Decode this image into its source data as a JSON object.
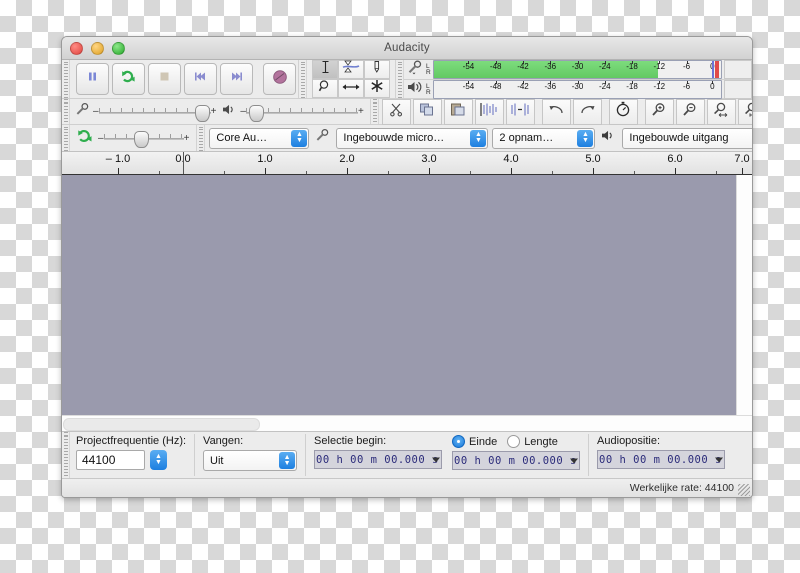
{
  "window": {
    "title": "Audacity",
    "traffic_lights": [
      "close-red",
      "minimize-yellow",
      "maximize-green"
    ]
  },
  "transport": {
    "buttons": [
      {
        "name": "pause-button",
        "icon": "pause-icon",
        "label": "Pause"
      },
      {
        "name": "play-button",
        "icon": "play-loop-icon",
        "label": "Play"
      },
      {
        "name": "stop-button",
        "icon": "stop-icon",
        "label": "Stop"
      },
      {
        "name": "skip-start-button",
        "icon": "skip-to-start-icon",
        "label": "Skip to Start"
      },
      {
        "name": "skip-end-button",
        "icon": "skip-to-end-icon",
        "label": "Skip to End"
      },
      {
        "name": "record-button",
        "icon": "record-icon",
        "label": "Record"
      }
    ]
  },
  "tools": {
    "items": [
      {
        "name": "selection-tool",
        "icon": "i-beam-icon",
        "active": true
      },
      {
        "name": "envelope-tool",
        "icon": "envelope-icon",
        "active": false
      },
      {
        "name": "draw-tool",
        "icon": "pencil-icon",
        "active": false
      },
      {
        "name": "zoom-tool",
        "icon": "magnifier-icon",
        "active": false
      },
      {
        "name": "timeshift-tool",
        "icon": "arrows-horizontal-icon",
        "active": false
      },
      {
        "name": "multi-tool",
        "icon": "asterisk-icon",
        "active": false
      }
    ]
  },
  "meters": {
    "record": {
      "icon": "microphone-icon",
      "channels": [
        "L",
        "R"
      ],
      "ticks": [
        "-54",
        "-48",
        "-42",
        "-36",
        "-30",
        "-24",
        "-18",
        "-12",
        "-6",
        "0"
      ],
      "level_percent": 78
    },
    "play": {
      "icon": "speaker-icon",
      "channels": [
        "L",
        "R"
      ],
      "ticks": [
        "-54",
        "-48",
        "-42",
        "-36",
        "-30",
        "-24",
        "-18",
        "-12",
        "-6",
        "0"
      ],
      "level_percent": 0
    }
  },
  "mixer": {
    "record_icon": "microphone-icon",
    "play_icon": "speaker-icon",
    "minus": "–",
    "plus": "+",
    "record_value_percent": 86,
    "play_value_percent": 5
  },
  "edit_toolbar": {
    "buttons": [
      {
        "name": "cut-button",
        "icon": "scissors-icon"
      },
      {
        "name": "copy-button",
        "icon": "copy-icon"
      },
      {
        "name": "paste-button",
        "icon": "paste-icon"
      },
      {
        "name": "trim-button",
        "icon": "trim-audio-icon"
      },
      {
        "name": "silence-button",
        "icon": "silence-audio-icon"
      },
      {
        "name": "undo-button",
        "icon": "undo-arrow-icon"
      },
      {
        "name": "redo-button",
        "icon": "redo-arrow-icon"
      },
      {
        "name": "sync-lock-button",
        "icon": "stopwatch-icon"
      },
      {
        "name": "zoom-in-button",
        "icon": "zoom-in-icon"
      },
      {
        "name": "zoom-out-button",
        "icon": "zoom-out-icon"
      },
      {
        "name": "fit-selection-button",
        "icon": "zoom-fit-selection-icon"
      },
      {
        "name": "fit-project-button",
        "icon": "zoom-fit-project-icon"
      }
    ]
  },
  "transcription": {
    "play_at_speed_icon": "play-at-speed-icon"
  },
  "device_toolbar": {
    "host_icon": "loop-green-icon",
    "host": "Core Au…",
    "input_icon": "microphone-icon",
    "input_device": "Ingebouwde micro…",
    "channels": "2 opnam…",
    "output_icon": "speaker-icon",
    "output_device": "Ingebouwde uitgang"
  },
  "ruler": {
    "labels": [
      "– 1.0",
      "0.0",
      "1.0",
      "2.0",
      "3.0",
      "4.0",
      "5.0",
      "6.0",
      "7.0"
    ],
    "playhead_label": "0.0"
  },
  "selection_bar": {
    "project_rate_label": "Projectfrequentie (Hz):",
    "project_rate_value": "44100",
    "snap_label": "Vangen:",
    "snap_value": "Uit",
    "selection_start_label": "Selectie begin:",
    "selection_start_value": "00 h 00 m 00.000 s",
    "end_radio_label": "Einde",
    "end_radio_selected": true,
    "length_radio_label": "Lengte",
    "length_radio_selected": false,
    "selection_end_value": "00 h 00 m 00.000 s",
    "audio_position_label": "Audiopositie:",
    "audio_position_value": "00 h 00 m 00.000 s"
  },
  "status_bar": {
    "actual_rate": "Werkelijke rate: 44100"
  }
}
